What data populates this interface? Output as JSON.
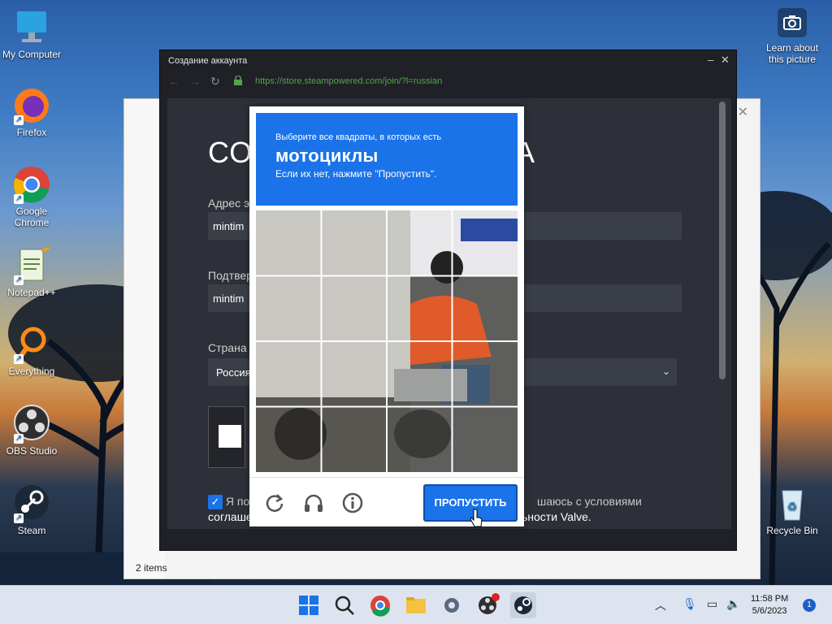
{
  "desktop": {
    "icons": [
      {
        "label": "My Computer"
      },
      {
        "label": "Firefox"
      },
      {
        "label": "Google Chrome"
      },
      {
        "label": "Notepad++"
      },
      {
        "label": "Everything"
      },
      {
        "label": "OBS Studio"
      },
      {
        "label": "Steam"
      },
      {
        "label": "Recycle Bin"
      }
    ],
    "learn_about": "Learn about this picture"
  },
  "explorer": {
    "status": "2 items"
  },
  "steam_dialog": {
    "title": "Создание аккаунта",
    "url": "https://store.steampowered.com/join/?l=russian",
    "page": {
      "heading_left": "СО",
      "heading_right": "А",
      "email_label": "Адрес э",
      "email_value": "mintim",
      "confirm_label": "Подтвер",
      "confirm_value": "mintim",
      "country_label": "Страна",
      "country_value": "Россия",
      "agree_prefix": "Я по",
      "agree_suffix": "шаюсь с условиями",
      "agree_line2_left": "соглаше",
      "agree_line2_right": "ьности Valve."
    }
  },
  "captcha": {
    "instruction_top": "Выберите все квадраты, в которых есть",
    "target": "мотоциклы",
    "instruction_bottom": "Если их нет, нажмите \"Пропустить\".",
    "skip_label": "ПРОПУСТИТЬ",
    "grid": {
      "rows": 4,
      "cols": 4
    }
  },
  "taskbar": {
    "time": "11:58 PM",
    "date": "5/6/2023",
    "notifications": "1"
  },
  "colors": {
    "captcha_blue": "#1a73e8",
    "steam_bg": "#1f2126",
    "url_green": "#56a34f"
  }
}
